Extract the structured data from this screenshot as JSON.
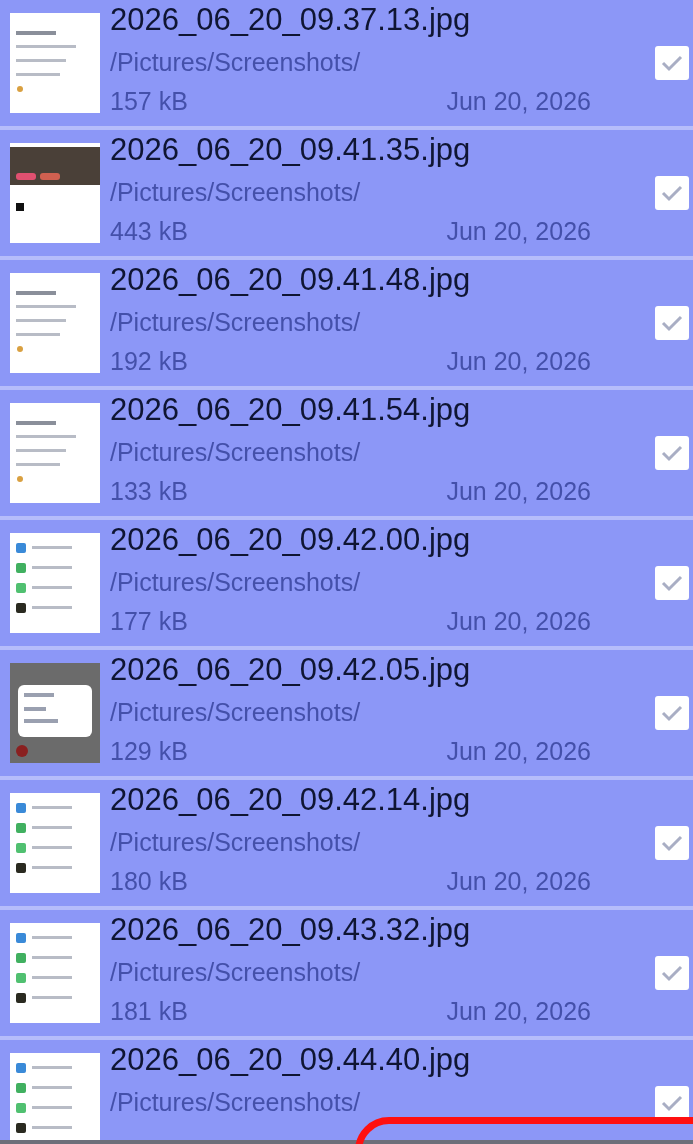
{
  "files": [
    {
      "name": "2026_06_20_09.37.13.jpg",
      "path": "/Pictures/Screenshots/",
      "size": "157 kB",
      "date": "Jun 20, 2026",
      "checked": true
    },
    {
      "name": "2026_06_20_09.41.35.jpg",
      "path": "/Pictures/Screenshots/",
      "size": "443 kB",
      "date": "Jun 20, 2026",
      "checked": true
    },
    {
      "name": "2026_06_20_09.41.48.jpg",
      "path": "/Pictures/Screenshots/",
      "size": "192 kB",
      "date": "Jun 20, 2026",
      "checked": true
    },
    {
      "name": "2026_06_20_09.41.54.jpg",
      "path": "/Pictures/Screenshots/",
      "size": "133 kB",
      "date": "Jun 20, 2026",
      "checked": true
    },
    {
      "name": "2026_06_20_09.42.00.jpg",
      "path": "/Pictures/Screenshots/",
      "size": "177 kB",
      "date": "Jun 20, 2026",
      "checked": true
    },
    {
      "name": "2026_06_20_09.42.05.jpg",
      "path": "/Pictures/Screenshots/",
      "size": "129 kB",
      "date": "Jun 20, 2026",
      "checked": true
    },
    {
      "name": "2026_06_20_09.42.14.jpg",
      "path": "/Pictures/Screenshots/",
      "size": "180 kB",
      "date": "Jun 20, 2026",
      "checked": true
    },
    {
      "name": "2026_06_20_09.43.32.jpg",
      "path": "/Pictures/Screenshots/",
      "size": "181 kB",
      "date": "Jun 20, 2026",
      "checked": true
    },
    {
      "name": "2026_06_20_09.44.40.jpg",
      "path": "/Pictures/Screenshots/",
      "checked": true
    }
  ]
}
